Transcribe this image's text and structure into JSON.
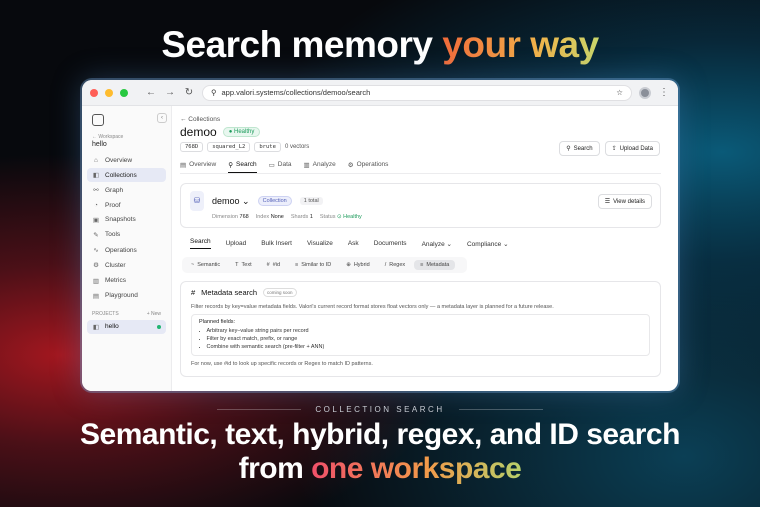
{
  "headline": {
    "prefix": "Search memory ",
    "highlight": "your way"
  },
  "browser": {
    "url": "app.valori.systems/collections/demoo/search",
    "colors": {
      "close": "#ff5f57",
      "minimize": "#febc2e",
      "maximize": "#28c840"
    }
  },
  "sidebar": {
    "workspace_label": "← Workspace",
    "workspace_name": "hello",
    "items": [
      {
        "label": "Overview",
        "icon": "⌂"
      },
      {
        "label": "Collections",
        "icon": "◧"
      },
      {
        "label": "Graph",
        "icon": "⚯"
      },
      {
        "label": "Proof",
        "icon": "◔"
      },
      {
        "label": "Snapshots",
        "icon": "▣"
      },
      {
        "label": "Tools",
        "icon": "✎"
      },
      {
        "label": "Operations",
        "icon": "∿"
      },
      {
        "label": "Cluster",
        "icon": "⚙"
      },
      {
        "label": "Metrics",
        "icon": "▥"
      },
      {
        "label": "Playground",
        "icon": "▤"
      }
    ],
    "projects_label": "PROJECTS",
    "new_label": "+ New",
    "project_name": "hello"
  },
  "main": {
    "breadcrumb": "← Collections",
    "title": "demoo",
    "status": "Healthy",
    "chips": [
      "768D",
      "squared_L2",
      "brute"
    ],
    "vectors": "0 vectors",
    "search_button": "Search",
    "upload_button": "Upload Data",
    "tabs": [
      "Overview",
      "Search",
      "Data",
      "Analyze",
      "Operations"
    ]
  },
  "collection_card": {
    "name": "demoo",
    "badge": "Collection",
    "total": "1 total",
    "dimension_label": "Dimension",
    "dimension": "768",
    "index_label": "Index",
    "index": "None",
    "shards_label": "Shards",
    "shards": "1",
    "status_label": "Status",
    "status": "Healthy",
    "view_details": "View details",
    "subtabs": [
      "Search",
      "Upload",
      "Bulk Insert",
      "Visualize",
      "Ask",
      "Documents",
      "Analyze",
      "Compliance"
    ],
    "modes": [
      {
        "icon": "~",
        "label": "Semantic"
      },
      {
        "icon": "T",
        "label": "Text"
      },
      {
        "icon": "#",
        "label": "#id"
      },
      {
        "icon": "≡",
        "label": "Similar to ID"
      },
      {
        "icon": "⊕",
        "label": "Hybrid"
      },
      {
        "icon": "/",
        "label": "Regex"
      },
      {
        "icon": "≡",
        "label": "Metadata"
      }
    ]
  },
  "metadata": {
    "icon": "#",
    "title": "Metadata search",
    "soon": "coming soon",
    "description": "Filter records by key=value metadata fields. Valori's current record format stores float vectors only — a metadata layer is planned for a future release.",
    "planned_title": "Planned fields:",
    "planned": [
      "Arbitrary key–value string pairs per record",
      "Filter by exact match, prefix, or range",
      "Combine with semantic search (pre-filter + ANN)"
    ],
    "footer": "For now, use #id to look up specific records or Regex to match ID patterns."
  },
  "section_label": "COLLECTION SEARCH",
  "tagline": {
    "line1": "Semantic, text, hybrid, regex, and ID search",
    "line2_prefix": "from ",
    "line2_highlight": "one workspace"
  }
}
